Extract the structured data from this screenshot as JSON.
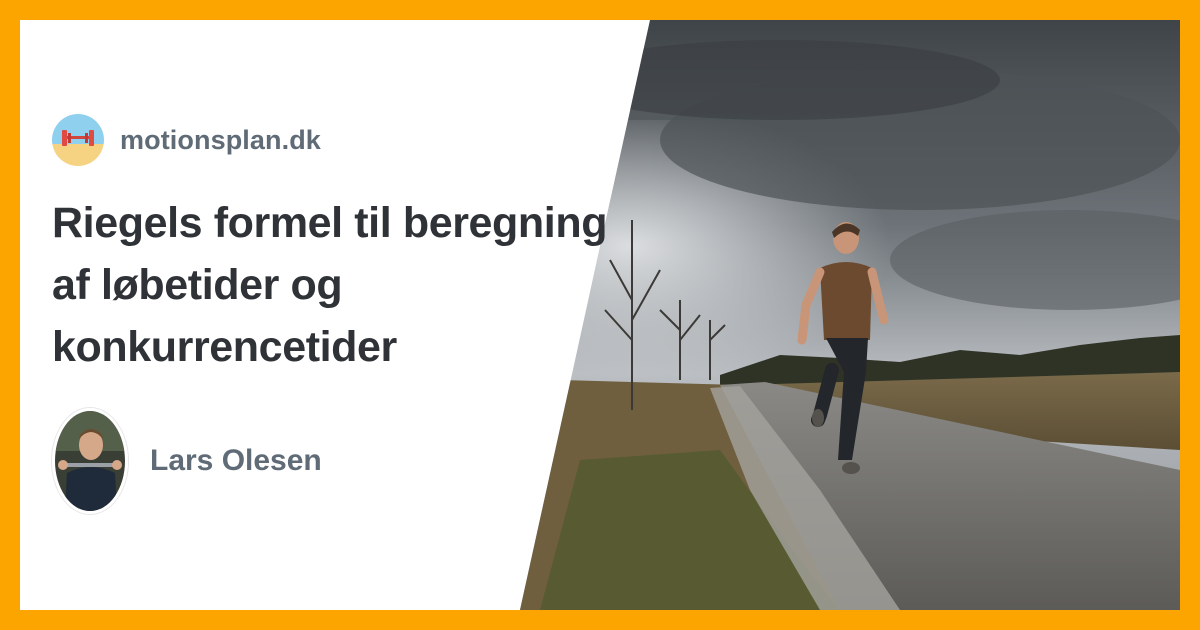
{
  "site": {
    "name": "motionsplan.dk",
    "logo_icon": "barbell-beach-logo-icon"
  },
  "article": {
    "title": "Riegels formel til beregning af løbetider og konkurrencetider"
  },
  "author": {
    "name": "Lars Olesen",
    "avatar_icon": "author-photo"
  },
  "hero_image": {
    "subject": "runner-on-gravel-road"
  },
  "colors": {
    "frame": "#fca500",
    "card": "#ffffff",
    "title": "#2f3237",
    "muted": "#5f6b76"
  }
}
